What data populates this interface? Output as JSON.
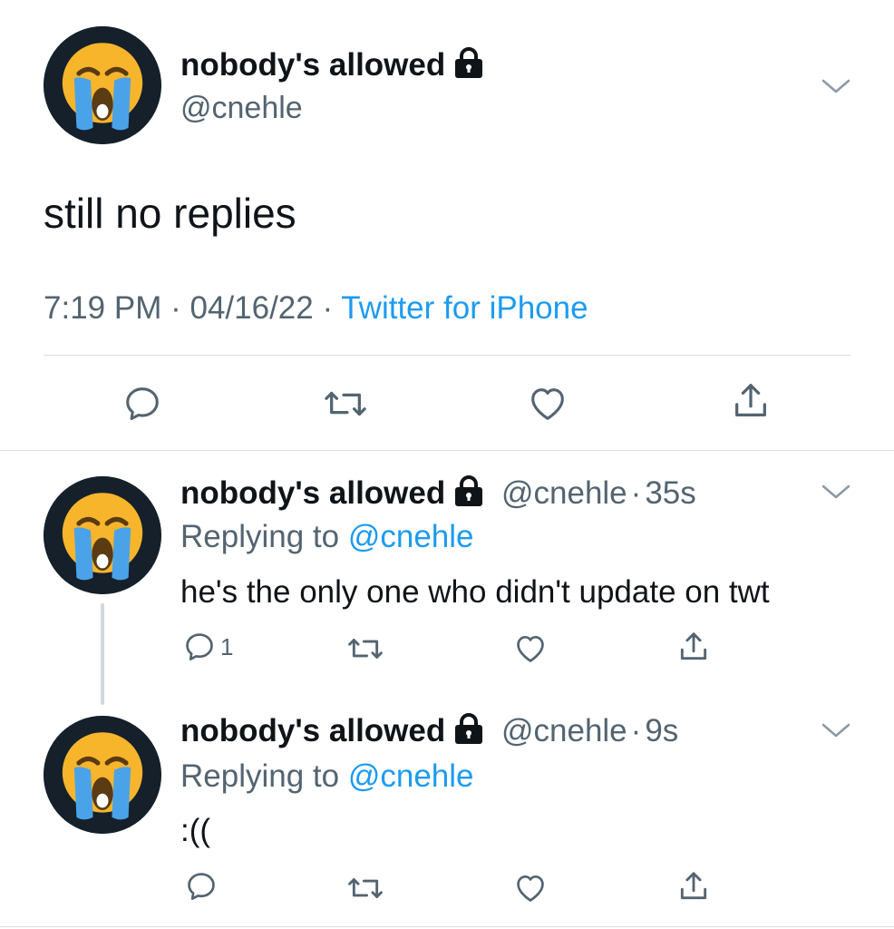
{
  "main_tweet": {
    "display_name": "nobody's allowed",
    "handle": "@cnehle",
    "text": "still no replies",
    "time": "7:19 PM",
    "date": "04/16/22",
    "source": "Twitter for iPhone",
    "meta_sep": "·",
    "icons": [
      "reply-icon",
      "retweet-icon",
      "like-icon",
      "share-icon"
    ]
  },
  "replies": [
    {
      "display_name": "nobody's allowed",
      "handle": "@cnehle",
      "dot": "·",
      "age": "35s",
      "replying_prefix": "Replying to",
      "replying_handle": "@cnehle",
      "text": "he's the only one who didn't update on twt",
      "reply_count": "1"
    },
    {
      "display_name": "nobody's allowed",
      "handle": "@cnehle",
      "dot": "·",
      "age": "9s",
      "replying_prefix": "Replying to",
      "replying_handle": "@cnehle",
      "text": ":((",
      "reply_count": ""
    }
  ],
  "colors": {
    "text": "#0f1419",
    "secondary": "#536471",
    "link": "#1d9bf0",
    "divider": "#d9dee2",
    "avatar_bg": "#15202b",
    "emoji_yellow": "#f7b52c",
    "tears_blue": "#4aa3e8"
  },
  "avatar_emoji": "loudly-crying-face"
}
